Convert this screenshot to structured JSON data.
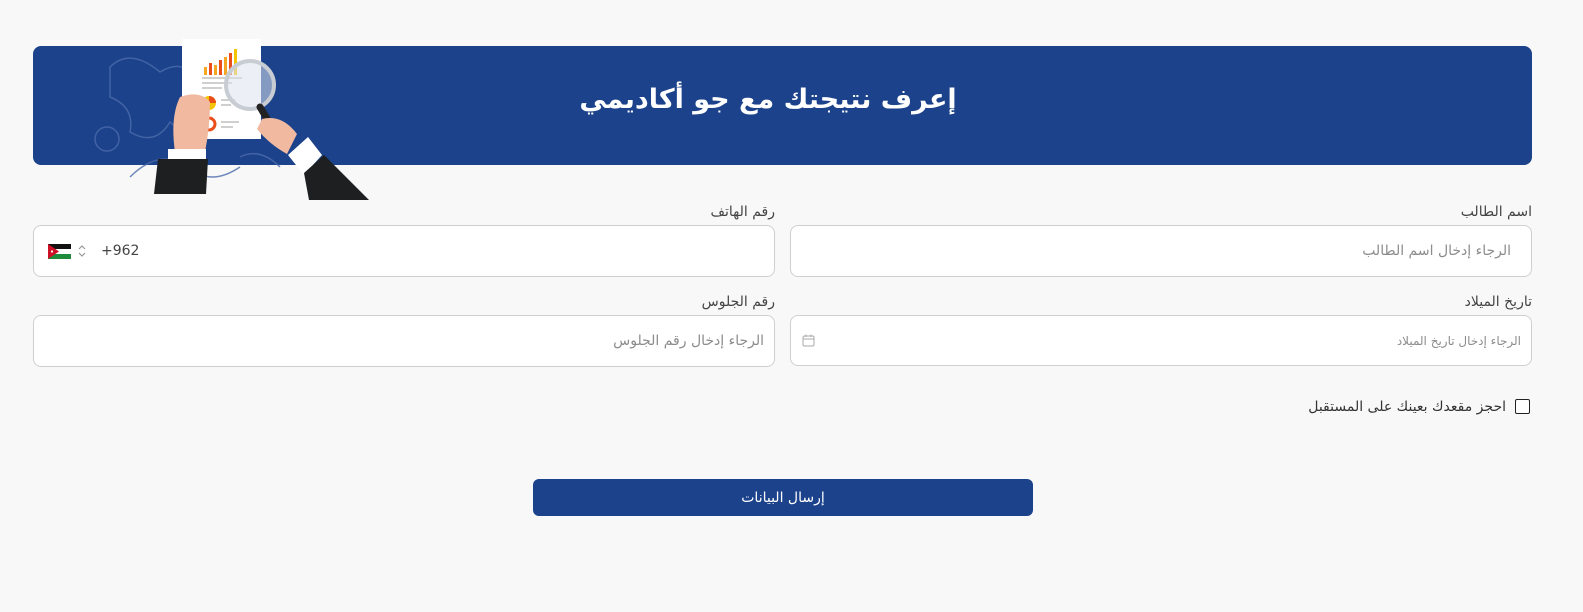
{
  "banner": {
    "title": "إعرف نتيجتك مع جو أكاديمي"
  },
  "form": {
    "student_name": {
      "label": "اسم الطالب",
      "placeholder": "الرجاء إدخال اسم الطالب",
      "value": ""
    },
    "phone": {
      "label": "رقم الهاتف",
      "country_code": "+962",
      "value": ""
    },
    "birth_date": {
      "label": "تاريخ الميلاد",
      "placeholder": "الرجاء إدخال تاريخ الميلاد",
      "value": ""
    },
    "seat_number": {
      "label": "رقم الجلوس",
      "placeholder": "الرجاء إدخال رقم الجلوس",
      "value": ""
    },
    "reserve_seat": {
      "label": "احجز مقعدك بعينك على المستقبل",
      "checked": false
    },
    "submit_label": "إرسال البيانات"
  },
  "icons": {
    "flag": "jordan-flag-icon",
    "chevron": "chevron-up-down-icon",
    "calendar": "calendar-icon",
    "illustration": "report-analysis-illustration"
  },
  "colors": {
    "primary": "#1b428a",
    "background": "#f8f8f8",
    "border": "#cfcfcf"
  }
}
